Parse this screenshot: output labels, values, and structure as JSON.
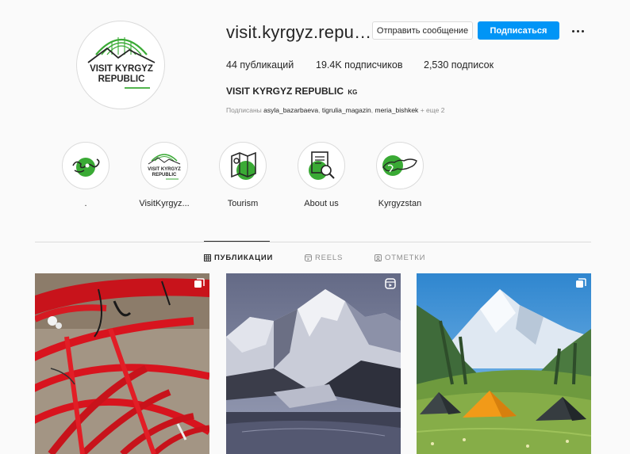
{
  "profile": {
    "username": "visit.kyrgyz.repu…",
    "message_label": "Отправить сообщение",
    "follow_label": "Подписаться",
    "logo_line1": "VISIT KYRGYZ",
    "logo_line2": "REPUBLIC",
    "stats": {
      "posts_value": "44",
      "posts_label": "публикаций",
      "followers_value": "19.4K",
      "followers_label": "подписчиков",
      "following_value": "2,530",
      "following_label": "подписок"
    },
    "full_name": "VISIT KYRGYZ REPUBLIC",
    "country_code": "KG",
    "followed_by_prefix": "Подписаны",
    "followed_by_users": [
      "asyla_bazarbaeva",
      "tigrulia_magazin",
      "meria_bishkek"
    ],
    "followed_by_more": "+ еще 2"
  },
  "highlights": [
    {
      "label": ".",
      "icon": "kyrgyz-ornament-icon"
    },
    {
      "label": "VisitKyrgyz...",
      "icon": "brand-logo-icon",
      "logo_line1": "VISIT KYRGYZ",
      "logo_line2": "REPUBLIC"
    },
    {
      "label": "Tourism",
      "icon": "map-icon"
    },
    {
      "label": "About us",
      "icon": "document-search-icon"
    },
    {
      "label": "Kyrgyzstan",
      "icon": "country-map-icon"
    }
  ],
  "tabs": [
    {
      "label": "ПУБЛИКАЦИИ",
      "icon": "grid-icon",
      "active": true
    },
    {
      "label": "REELS",
      "icon": "reels-icon",
      "active": false
    },
    {
      "label": "ОТМЕТКИ",
      "icon": "tagged-icon",
      "active": false
    }
  ],
  "posts": [
    {
      "subject": "red yurt frame",
      "badge": "carousel-icon"
    },
    {
      "subject": "snowy mountain lake",
      "badge": "reels-icon"
    },
    {
      "subject": "tents under mountain peak",
      "badge": "carousel-icon"
    }
  ],
  "colors": {
    "accent_blue": "#0095f6",
    "brand_green": "#3aaa35",
    "text": "#262626",
    "muted": "#8e8e8e",
    "border": "#dbdbdb",
    "background": "#fafafa"
  }
}
